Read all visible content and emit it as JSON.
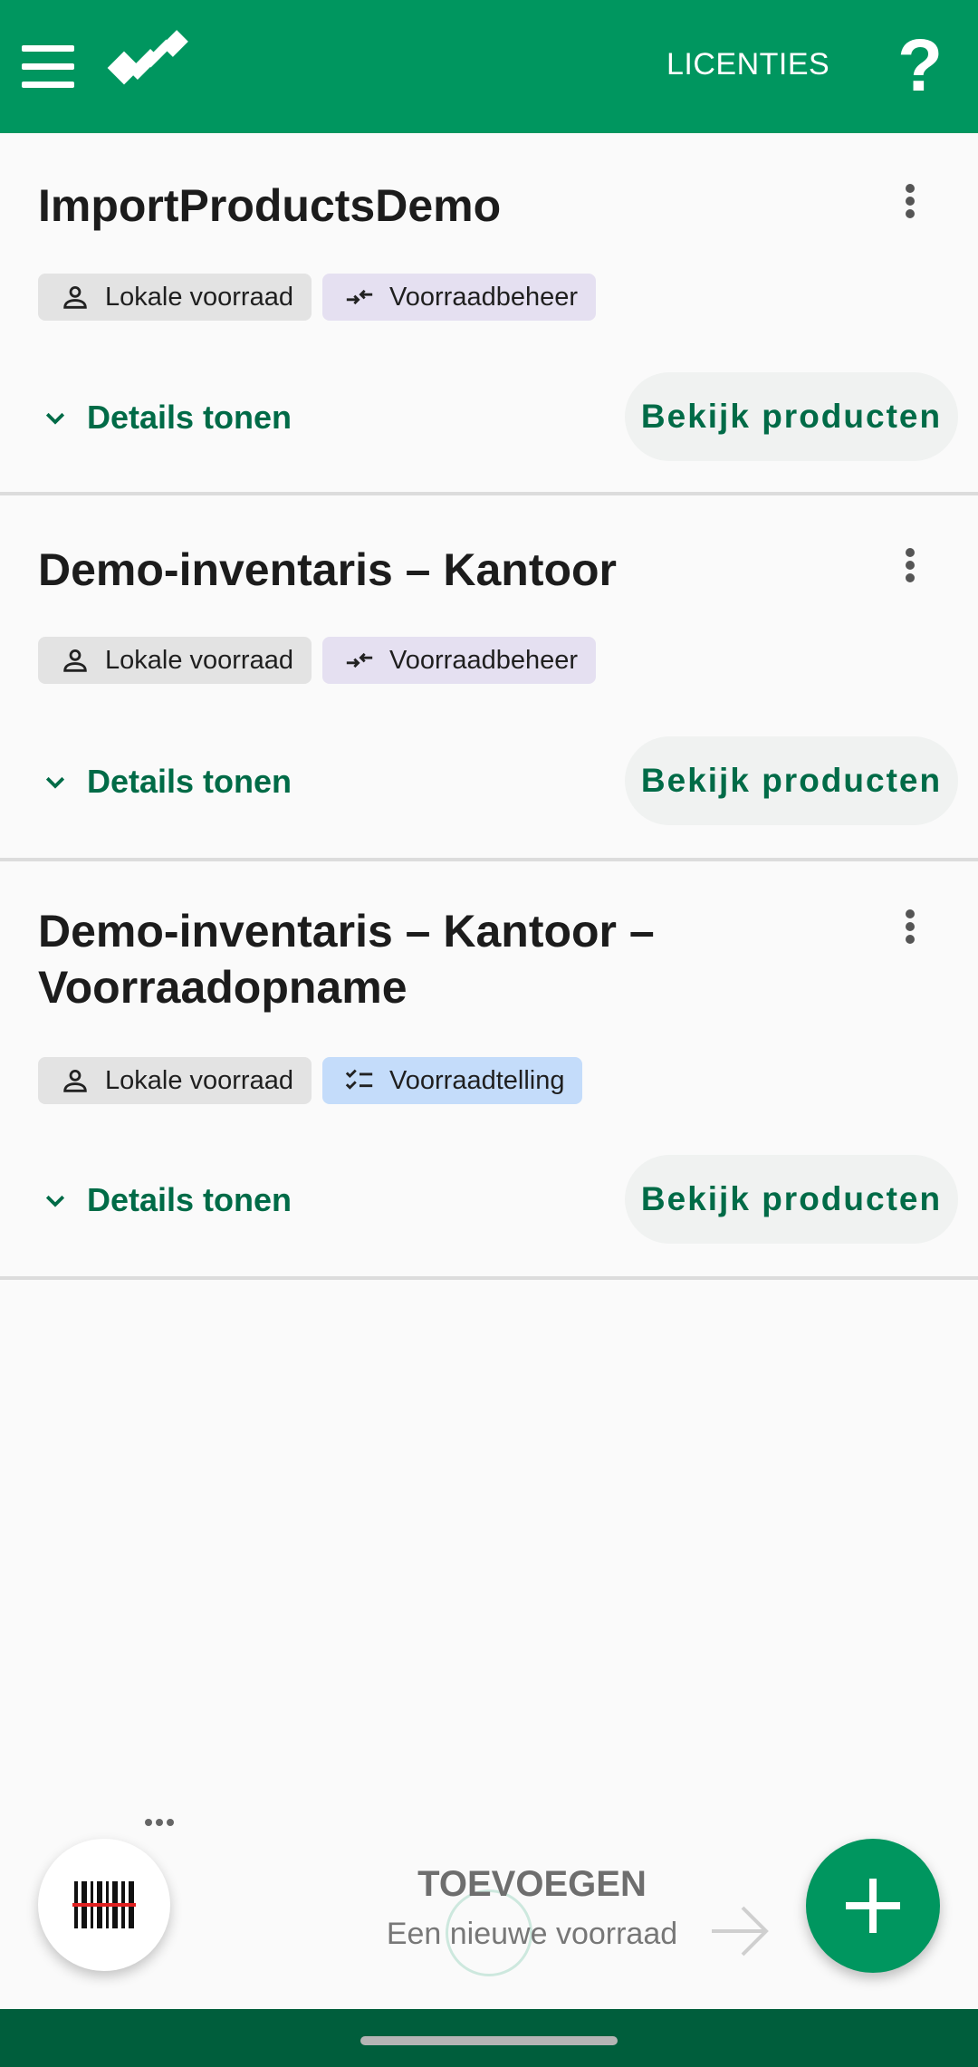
{
  "app": {
    "licenses_label": "LICENTIES",
    "help_label": "?",
    "accent_color": "#00965f",
    "dark_accent_color": "#006b47"
  },
  "inventories": [
    {
      "title": "ImportProductsDemo",
      "chips": [
        {
          "label": "Lokale voorraad",
          "icon": "person-icon",
          "color": "#e3e3e3"
        },
        {
          "label": "Voorraadbeheer",
          "icon": "swap-arrows-icon",
          "color": "#e5e0f1"
        }
      ],
      "details_label": "Details tonen",
      "view_label": "Bekijk producten"
    },
    {
      "title": "Demo-inventaris – Kantoor",
      "chips": [
        {
          "label": "Lokale voorraad",
          "icon": "person-icon",
          "color": "#e3e3e3"
        },
        {
          "label": "Voorraadbeheer",
          "icon": "swap-arrows-icon",
          "color": "#e5e0f1"
        }
      ],
      "details_label": "Details tonen",
      "view_label": "Bekijk producten"
    },
    {
      "title": "Demo-inventaris – Kantoor – Voorraadopname",
      "chips": [
        {
          "label": "Lokale voorraad",
          "icon": "person-icon",
          "color": "#e3e3e3"
        },
        {
          "label": "Voorraadtelling",
          "icon": "checklist-icon",
          "color": "#c4dcfa"
        }
      ],
      "details_label": "Details tonen",
      "view_label": "Bekijk producten"
    }
  ],
  "add_hint": {
    "title": "TOEVOEGEN",
    "subtitle": "Een nieuwe voorraad"
  }
}
